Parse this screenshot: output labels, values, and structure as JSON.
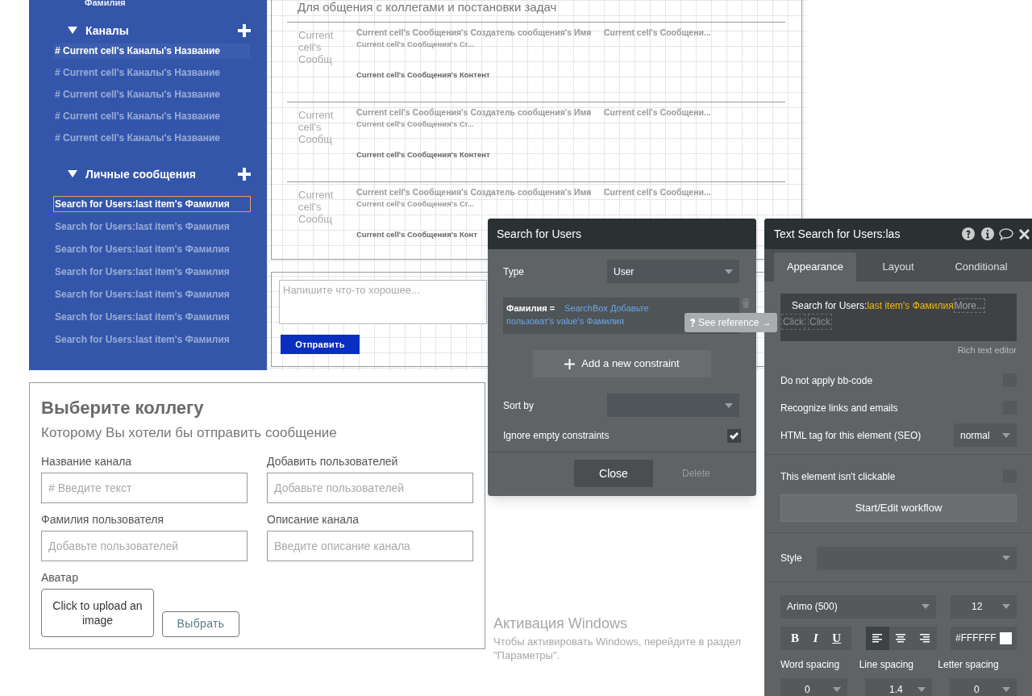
{
  "sidebar": {
    "top_item": "Фамилия",
    "sections": [
      {
        "title": "Каналы",
        "expanded": true,
        "items": [
          {
            "label": "# Current cell's Каналы's Название",
            "selected": true
          },
          {
            "label": "# Current cell's Каналы's Название",
            "selected": false
          },
          {
            "label": "# Current cell's Каналы's Название",
            "selected": false
          },
          {
            "label": "# Current cell's Каналы's Название",
            "selected": false
          },
          {
            "label": "# Current cell's Каналы's Название",
            "selected": false
          }
        ]
      },
      {
        "title": "Личные сообщения",
        "expanded": true,
        "items": [
          {
            "label": "Search for Users:last item's Фамилия",
            "selected": true
          },
          {
            "label": "Search for Users:last item's Фамилия",
            "selected": false
          },
          {
            "label": "Search for Users:last item's Фамилия",
            "selected": false
          },
          {
            "label": "Search for Users:last item's Фамилия",
            "selected": false
          },
          {
            "label": "Search for Users:last item's Фамилия",
            "selected": false
          },
          {
            "label": "Search for Users:last item's Фамилия",
            "selected": false
          },
          {
            "label": "Search for Users:last item's Фамилия",
            "selected": false
          }
        ]
      }
    ]
  },
  "canvas": {
    "title": "Для общения с коллегами и постановки задач",
    "rows": [
      {
        "avatar_text": "Current cell's Сообщ",
        "name": "Current cell's Сообщения's Создатель сообщения's Имя",
        "date": "Current cell's Сообщени...",
        "created": "Current cell's Сообщения's Cr...",
        "content": "Current cell's Сообщения's Контент"
      },
      {
        "avatar_text": "Current cell's Сообщ",
        "name": "Current cell's Сообщения's Создатель сообщения's Имя",
        "date": "Current cell's Сообщени...",
        "created": "Current cell's Сообщения's Cr...",
        "content": "Current cell's Сообщения's Контент"
      },
      {
        "avatar_text": "Current cell's Сообщ",
        "name": "Current cell's Сообщения's Создатель сообщения's Имя",
        "date": "Current cell's Сообщени...",
        "created": "Current cell's Сообщения's Cr...",
        "content": "Current cell's Сообщения's Конт"
      }
    ],
    "composer": {
      "placeholder": "Напишите что-то хорошее...",
      "button": "Отправить"
    }
  },
  "popup": {
    "title": "Выберите коллегу",
    "subtitle": "Которому Вы хотели бы отправить сообщение",
    "fields": [
      {
        "label": "Название канала",
        "placeholder": "# Введите текст"
      },
      {
        "label": "Добавить пользователей",
        "placeholder": "Добавьте пользователей"
      },
      {
        "label": "Фамилия пользователя",
        "placeholder": "Добавьте пользователей"
      },
      {
        "label": "Описание канала",
        "placeholder": "Введите описание канала"
      }
    ],
    "avatar": {
      "label": "Аватар",
      "upload_text": "Click to upload an image",
      "button": "Выбрать"
    }
  },
  "search_panel": {
    "title": "Search for Users",
    "type_label": "Type",
    "type_value": "User",
    "constraint": {
      "field": "Фамилия =",
      "value": "SearchBox Добавьте пользоват's value's Фамилия"
    },
    "add_button": "Add a new constraint",
    "sort_label": "Sort by",
    "ignore_label": "Ignore empty constraints",
    "ignore_checked": true,
    "close_button": "Close",
    "delete_button": "Delete",
    "delete_disabled": true
  },
  "tooltip": {
    "text": "See reference →"
  },
  "property_panel": {
    "title": "Text Search for Users:las",
    "tabs": [
      {
        "label": "Appearance",
        "selected": true
      },
      {
        "label": "Layout",
        "selected": false
      },
      {
        "label": "Conditional",
        "selected": false
      }
    ],
    "rich_text": {
      "prefix": "Search for Users:",
      "dynamic": "last item's Фамилия",
      "more": "More...",
      "chips": [
        "Click",
        "Click"
      ]
    },
    "rich_text_caption": "Rich text editor",
    "options": [
      {
        "kind": "checkbox",
        "label": "Do not apply bb-code",
        "checked": false
      },
      {
        "kind": "checkbox",
        "label": "Recognize links and emails",
        "checked": false
      },
      {
        "kind": "dropdown",
        "label": "HTML tag for this element (SEO)",
        "value": "normal"
      },
      {
        "kind": "checkbox",
        "label": "This element isn't clickable",
        "checked": false
      }
    ],
    "workflow_button": "Start/Edit workflow",
    "style_label": "Style",
    "font": "Arimo (500)",
    "font_size": "12",
    "format_buttons": [
      "B",
      "I",
      "U"
    ],
    "alignments": [
      {
        "kind": "left",
        "selected": true
      },
      {
        "kind": "center",
        "selected": false
      },
      {
        "kind": "right",
        "selected": false
      }
    ],
    "color_value": "#FFFFFF",
    "spacing": [
      {
        "label": "Word spacing",
        "value": "0"
      },
      {
        "label": "Line spacing",
        "value": "1.4"
      },
      {
        "label": "Letter spacing",
        "value": "0"
      }
    ]
  },
  "os_notice": {
    "title": "Активация Windows",
    "text": "Чтобы активировать Windows, перейдите в раздел \"Параметры\"."
  }
}
